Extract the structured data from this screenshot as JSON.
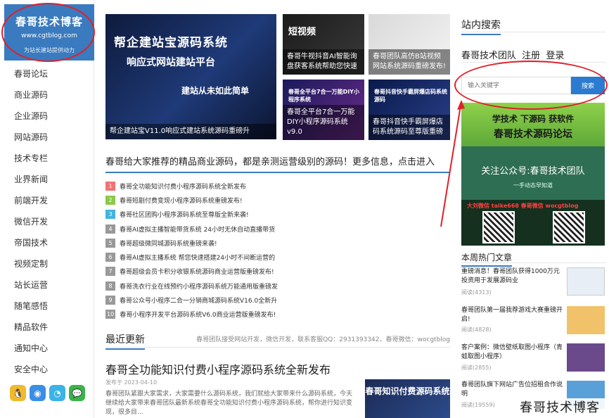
{
  "logo": {
    "title": "春哥技术博客",
    "url": "www.cgtblog.com",
    "slogan": "为站长建站提供动力"
  },
  "sidebar": {
    "items": [
      {
        "label": "春哥论坛"
      },
      {
        "label": "商业源码"
      },
      {
        "label": "企业源码"
      },
      {
        "label": "网站源码"
      },
      {
        "label": "技术专栏"
      },
      {
        "label": "业界新闻"
      },
      {
        "label": "前端开发"
      },
      {
        "label": "微信开发"
      },
      {
        "label": "帝国技术"
      },
      {
        "label": "视频定制"
      },
      {
        "label": "站长运营"
      },
      {
        "label": "随笔感悟"
      },
      {
        "label": "精品软件"
      },
      {
        "label": "通知中心"
      },
      {
        "label": "安全中心"
      }
    ],
    "social": [
      {
        "icon": "qq-icon",
        "glyph": "🐧",
        "color": "#f0b92e"
      },
      {
        "icon": "weibo-icon",
        "glyph": "◉",
        "color": "#3a8ee6"
      },
      {
        "icon": "tencent-weibo-icon",
        "glyph": "◔",
        "color": "#3ab3e6"
      },
      {
        "icon": "wechat-icon",
        "glyph": "💬",
        "color": "#3cb34a"
      }
    ]
  },
  "featured": {
    "big": {
      "line1": "帮企建站宝源码系统",
      "line2": "响应式网站建站平台",
      "line3": "建站从未如此简单",
      "caption": "帮企建站宝V11.0响应式建站系统源码重磅升"
    },
    "small": [
      {
        "image_text": "短视频",
        "caption": "春哥牛视抖音AI智能询盘获客系统帮助您快速"
      },
      {
        "image_text": "",
        "caption": "春哥团队高仿B站视频网站系统源码重磅发布!"
      },
      {
        "image_text": "春哥全平台7合一万能DIY小程序系统",
        "caption": "春哥全平台7合一万能DIY小程序源码系统v9.0"
      },
      {
        "image_text": "春哥抖音快手霸屏爆店码系统源码",
        "caption": "春哥抖音快手霸屏爆店码系统源码至尊版重磅"
      }
    ]
  },
  "recommend": {
    "title": "春哥给大家推荐的精品商业源码，都是亲测运营级别的源码！更多信息，点击进入",
    "items": [
      {
        "num": "1",
        "color": "#f07474",
        "text": "春哥全功能知识付费小程序源码系统全新发布"
      },
      {
        "num": "2",
        "color": "#8cc84b",
        "text": "春哥短剧付费变现小程序源码系统重磅发布!"
      },
      {
        "num": "3",
        "color": "#45b3e0",
        "text": "春哥社区团购小程序源码系统至尊版全新来袭!"
      },
      {
        "num": "4",
        "color": "#999999",
        "text": "春哥AI虚拟主播智能带货系统 24小时无休自动直播带货"
      },
      {
        "num": "5",
        "color": "#999999",
        "text": "春哥超级微同城源码系统重磅来袭!"
      },
      {
        "num": "6",
        "color": "#999999",
        "text": "春哥AI虚拟主播系统 帮您快速搭建24小时不间断运营的"
      },
      {
        "num": "7",
        "color": "#999999",
        "text": "春哥超级会员卡积分收银系统源码商业运营版重磅发布!"
      },
      {
        "num": "8",
        "color": "#999999",
        "text": "春哥洗衣行业在线预约小程序源码系统万能通用版重磅发"
      },
      {
        "num": "9",
        "color": "#999999",
        "text": "春哥公众号小程序二合一分销商城源码系统V16.0全新升"
      },
      {
        "num": "10",
        "color": "#999999",
        "text": "春哥小程序开发平台源码系统V6.0商业运营版重磅发布!"
      }
    ]
  },
  "recent": {
    "title": "最近更新",
    "note": "春哥团队接受网站开发，微信开发，联系客服QQ：2931393342，春哥微信：wocgtblog",
    "article": {
      "title": "春哥全功能知识付费小程序源码系统全新发布",
      "date": "发布于 2023-04-10",
      "excerpt": "春哥团队紧跟大家需求，大家需要什么源码系统，我们就给大家带来什么源码系统，今天继续给大家带来春哥团队最新系统春哥全功能知识付费小程序源码系统，帮你进行知识变现，很多目...",
      "thumb_text": "春哥知识付费源码系统"
    }
  },
  "right": {
    "search_title": "站内搜索",
    "team": "春哥技术团队",
    "register": "注册",
    "login": "登录",
    "search_placeholder": "输入关键字",
    "search_button": "搜索",
    "promo": {
      "line1": "学技术 下源码 获软件",
      "line2": "春哥技术源码论坛",
      "line3": "关注公众号:春哥技术团队",
      "line4": "一手动态早知道",
      "line5": "大刘微信 taike668    春哥微信 wocgtblog"
    },
    "hot_title": "本周热门文章",
    "hot": [
      {
        "title": "重磅消息！春哥团队获得1000万元投资用于发展源码业",
        "reads": "阅读(4313)",
        "thumb": "#e8eef6"
      },
      {
        "title": "春哥团队第一届我荐游戏大赛重磅开启!",
        "reads": "阅读(4828)",
        "thumb": "#f2c26a"
      },
      {
        "title": "客户案例：微信壁纸取图小程序（青蛙取图小程序）",
        "reads": "阅读(2855)",
        "thumb": "#6a4a8a"
      },
      {
        "title": "春哥团队旗下网站广告位招租合作说明",
        "reads": "阅读(19559)",
        "thumb": "#5aa0d8"
      }
    ]
  },
  "watermark": "春哥技术博客"
}
